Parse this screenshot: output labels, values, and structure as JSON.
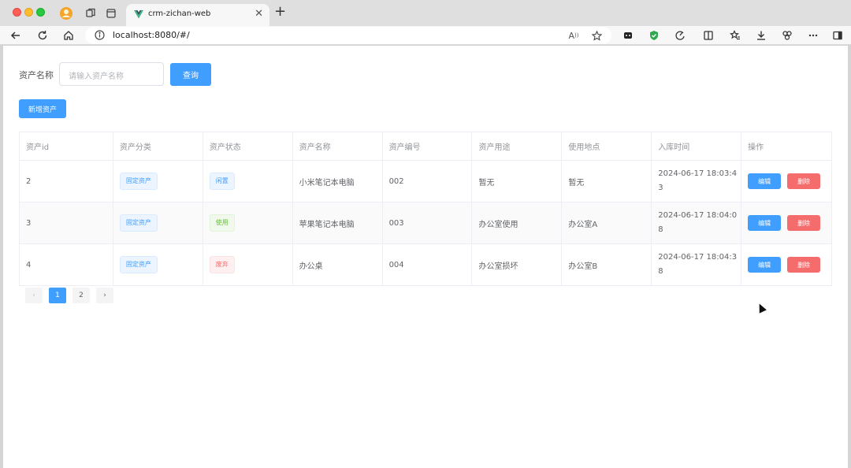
{
  "browser": {
    "tab_title": "crm-zichan-web",
    "url": "localhost:8080/#/"
  },
  "search": {
    "label": "资产名称",
    "placeholder": "请输入资产名称",
    "query_button": "查询"
  },
  "toolbar": {
    "add_button": "新增资产"
  },
  "table": {
    "columns": [
      "资产id",
      "资产分类",
      "资产状态",
      "资产名称",
      "资产编号",
      "资产用途",
      "使用地点",
      "入库时间",
      "操作"
    ],
    "rows": [
      {
        "id": "2",
        "category": "固定资产",
        "status": "闲置",
        "status_color": "blue",
        "name": "小米笔记本电脑",
        "code": "002",
        "usage": "暂无",
        "location": "暂无",
        "time": "2024-06-17 18:03:43"
      },
      {
        "id": "3",
        "category": "固定资产",
        "status": "使用",
        "status_color": "green",
        "name": "苹果笔记本电脑",
        "code": "003",
        "usage": "办公室使用",
        "location": "办公室A",
        "time": "2024-06-17 18:04:08"
      },
      {
        "id": "4",
        "category": "固定资产",
        "status": "废弃",
        "status_color": "red",
        "name": "办公桌",
        "code": "004",
        "usage": "办公室损坏",
        "location": "办公室B",
        "time": "2024-06-17 18:04:38"
      }
    ],
    "edit_label": "编辑",
    "delete_label": "删除"
  },
  "pagination": {
    "prev": "‹",
    "pages": [
      "1",
      "2"
    ],
    "current": "1",
    "next": "›"
  },
  "colors": {
    "primary": "#409eff",
    "danger": "#f56c6c",
    "success": "#67c23a"
  }
}
